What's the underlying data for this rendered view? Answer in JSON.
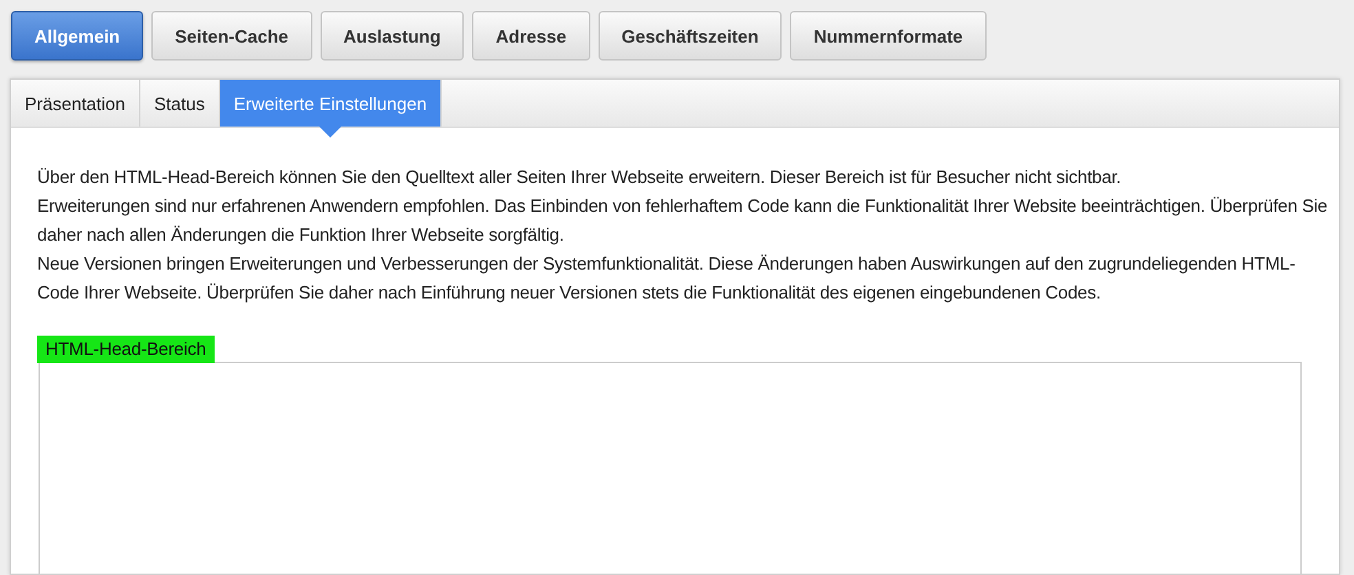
{
  "main_tabs": [
    {
      "label": "Allgemein",
      "selected": true
    },
    {
      "label": "Seiten-Cache",
      "selected": false
    },
    {
      "label": "Auslastung",
      "selected": false
    },
    {
      "label": "Adresse",
      "selected": false
    },
    {
      "label": "Geschäftszeiten",
      "selected": false
    },
    {
      "label": "Nummernformate",
      "selected": false
    }
  ],
  "sub_tabs": [
    {
      "label": "Präsentation",
      "selected": false
    },
    {
      "label": "Status",
      "selected": false
    },
    {
      "label": "Erweiterte Einstellungen",
      "selected": true
    }
  ],
  "description": [
    "Über den HTML-Head-Bereich können Sie den Quelltext aller Seiten Ihrer Webseite erweitern. Dieser Bereich ist für Besucher nicht sichtbar.",
    "Erweiterungen sind nur erfahrenen Anwendern empfohlen. Das Einbinden von fehlerhaftem Code kann die Funktionalität Ihrer Website beeinträchtigen. Überprüfen Sie daher nach allen Änderungen die Funktion Ihrer Webseite sorgfältig.",
    "Neue Versionen bringen Erweiterungen und Verbesserungen der Systemfunktionalität. Diese Änderungen haben Auswirkungen auf den zugrundeliegenden HTML-Code Ihrer Webseite. Überprüfen Sie daher nach Einführung neuer Versionen stets die Funktionalität des eigenen eingebundenen Codes."
  ],
  "head_field": {
    "label": "HTML-Head-Bereich"
  }
}
